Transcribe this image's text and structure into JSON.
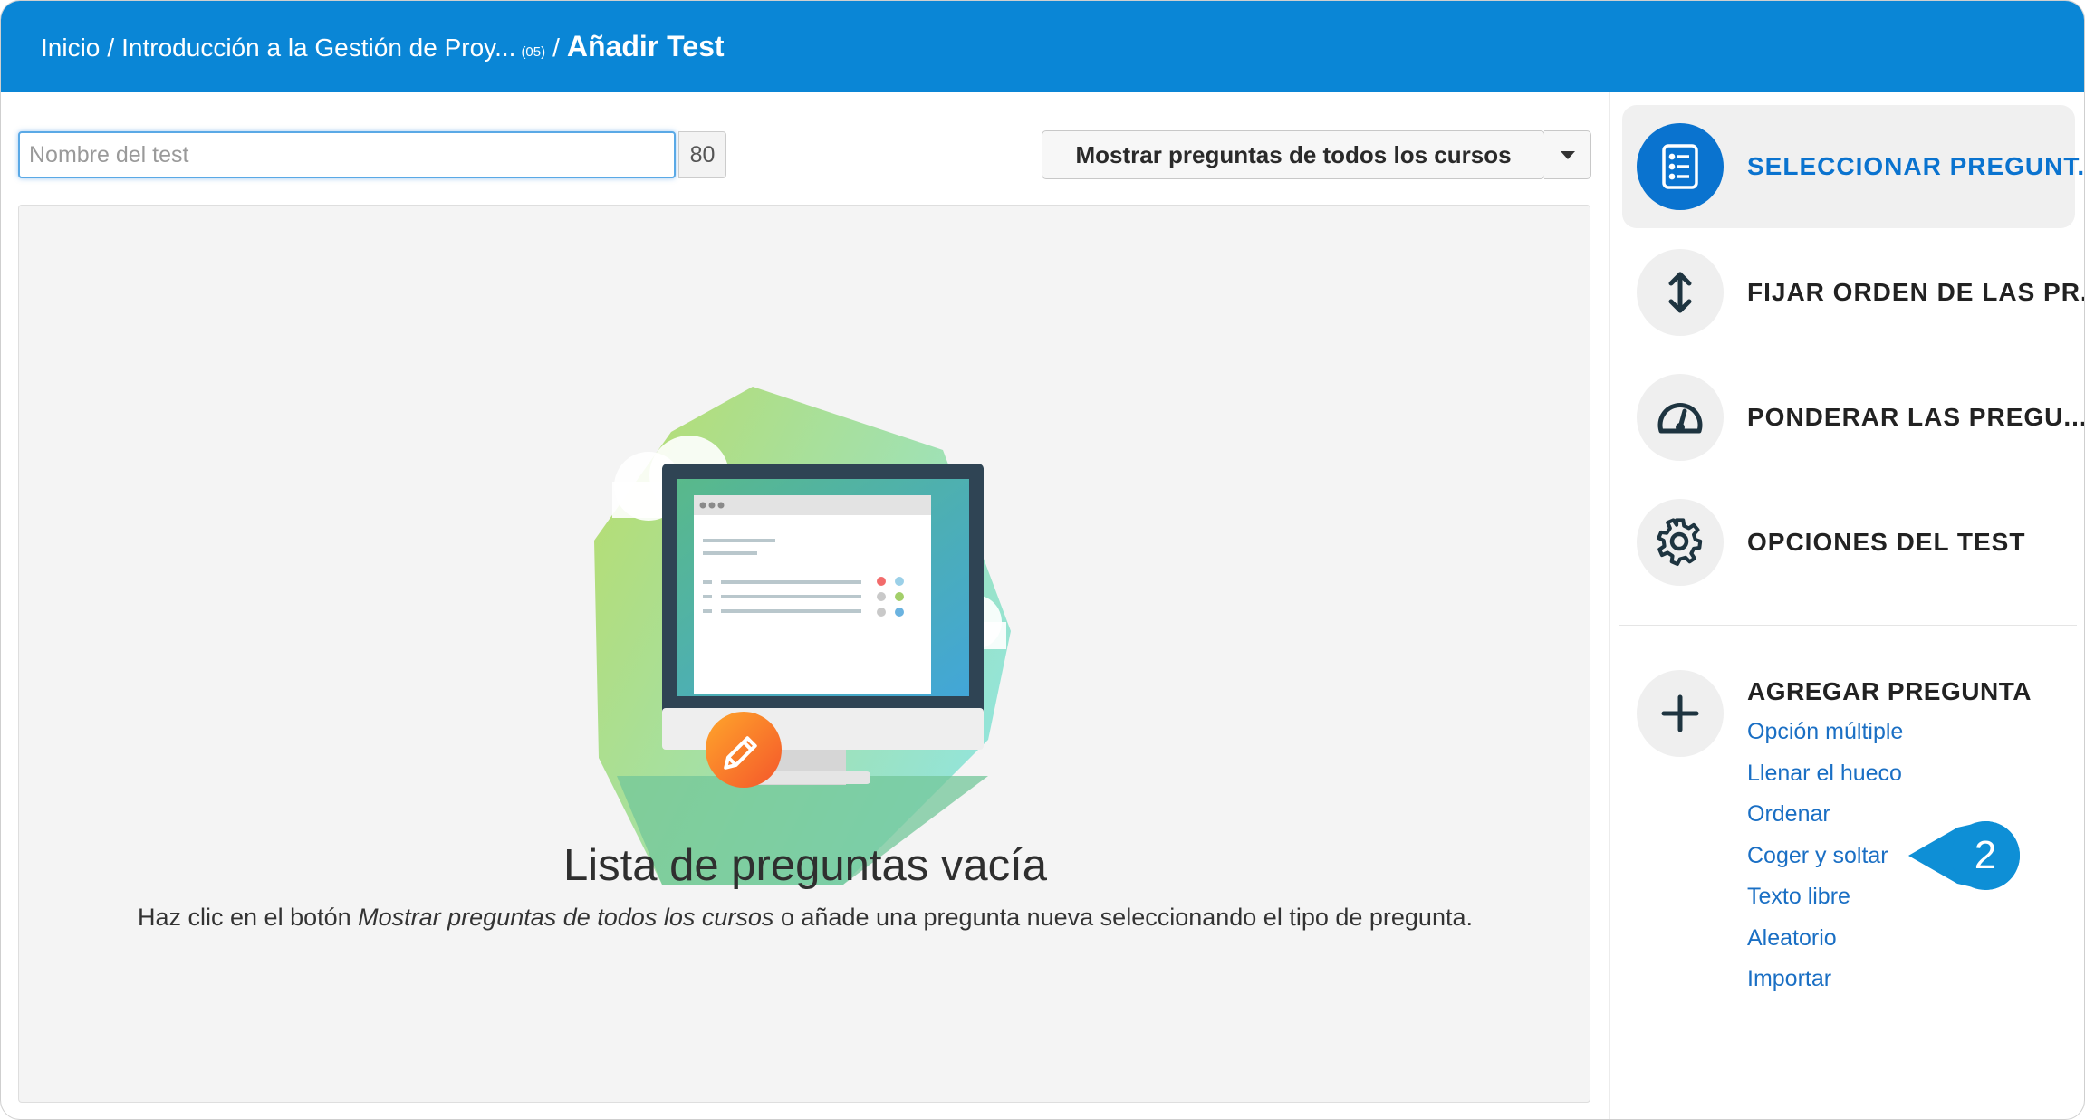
{
  "header": {
    "breadcrumb_home": "Inicio",
    "separator": "/",
    "breadcrumb_course": "Introducción a la Gestión de Proy...",
    "breadcrumb_course_code": "(05)",
    "current_page": "Añadir Test"
  },
  "form": {
    "name_placeholder": "Nombre del test",
    "name_value": "",
    "char_counter": "80"
  },
  "toolbar": {
    "show_all_label": "Mostrar preguntas de todos los cursos"
  },
  "empty_state": {
    "title": "Lista de preguntas vacía",
    "desc_before": "Haz clic en el botón ",
    "desc_emphasis": "Mostrar preguntas de todos los cursos",
    "desc_after": " o añade una pregunta nueva seleccionando el tipo de pregunta."
  },
  "sidebar": {
    "items": [
      {
        "label": "SELECCIONAR PREGUNT...",
        "icon": "checklist-icon",
        "active": true
      },
      {
        "label": "FIJAR ORDEN DE LAS PR...",
        "icon": "vertical-arrows-icon",
        "active": false
      },
      {
        "label": "PONDERAR LAS PREGU...",
        "icon": "gauge-icon",
        "active": false
      },
      {
        "label": "OPCIONES DEL TEST",
        "icon": "gear-icon",
        "active": false
      }
    ],
    "add_question": {
      "title": "AGREGAR PREGUNTA",
      "icon": "plus-icon",
      "types": [
        "Opción múltiple",
        "Llenar el hueco",
        "Ordenar",
        "Coger y soltar",
        "Texto libre",
        "Aleatorio",
        "Importar"
      ]
    }
  },
  "callout": {
    "number": "2"
  },
  "colors": {
    "header_blue": "#0a86d6",
    "active_blue": "#0a73cf",
    "link_blue": "#1a6fc4",
    "callout_blue": "#0e8fd6"
  }
}
